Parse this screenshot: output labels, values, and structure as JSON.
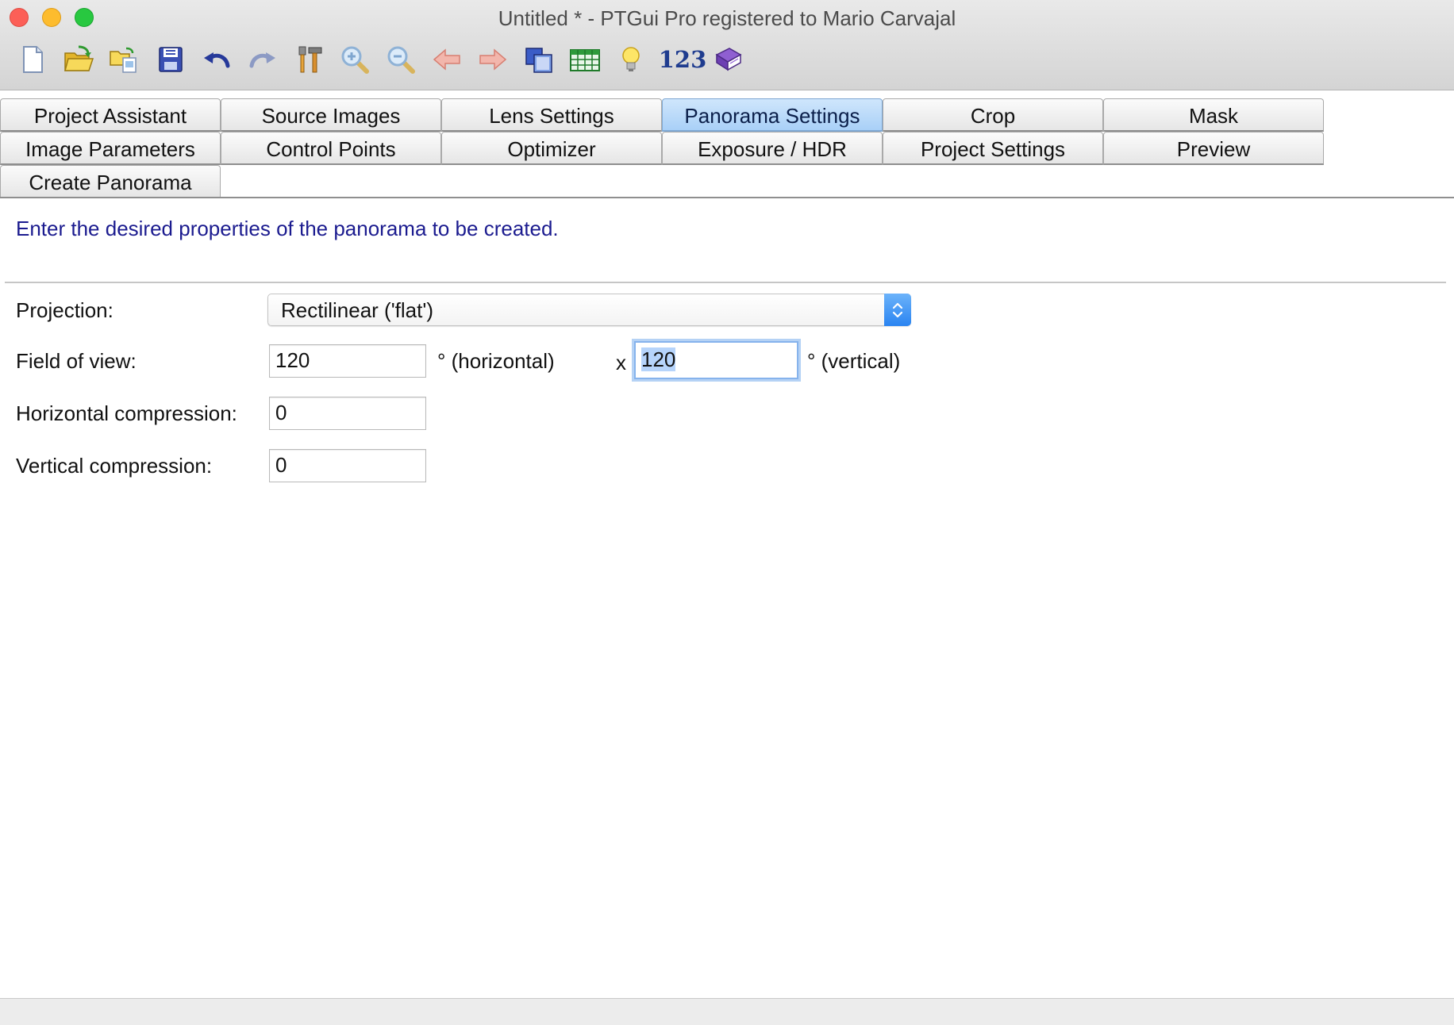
{
  "window": {
    "title": "Untitled * - PTGui Pro registered to Mario Carvajal"
  },
  "toolbar": {
    "buttons": [
      {
        "name": "new-project",
        "icon": "new-document-icon"
      },
      {
        "name": "open-project",
        "icon": "open-folder-icon"
      },
      {
        "name": "load-images",
        "icon": "load-images-icon"
      },
      {
        "name": "save-project",
        "icon": "save-disk-icon"
      },
      {
        "name": "undo",
        "icon": "undo-arrow-icon"
      },
      {
        "name": "redo",
        "icon": "redo-arrow-icon"
      },
      {
        "name": "tools",
        "icon": "tools-icon"
      },
      {
        "name": "zoom-in",
        "icon": "zoom-in-icon"
      },
      {
        "name": "zoom-out",
        "icon": "zoom-out-icon"
      },
      {
        "name": "back",
        "icon": "arrow-left-icon"
      },
      {
        "name": "forward",
        "icon": "arrow-right-icon"
      },
      {
        "name": "panorama-editor",
        "icon": "panorama-editor-icon"
      },
      {
        "name": "table",
        "icon": "table-icon"
      },
      {
        "name": "tips",
        "icon": "lightbulb-icon"
      },
      {
        "name": "numbers",
        "label": "123"
      },
      {
        "name": "help",
        "icon": "help-book-icon"
      }
    ]
  },
  "tabs": {
    "row1": [
      "Project Assistant",
      "Source Images",
      "Lens Settings",
      "Panorama Settings",
      "Crop",
      "Mask"
    ],
    "row2": [
      "Image Parameters",
      "Control Points",
      "Optimizer",
      "Exposure / HDR",
      "Project Settings",
      "Preview"
    ],
    "row3": [
      "Create Panorama"
    ],
    "active": "Panorama Settings"
  },
  "panorama_settings": {
    "hint": "Enter the desired properties of the panorama to be created.",
    "projection_label": "Projection:",
    "projection_value": "Rectilinear ('flat')",
    "fov_label": "Field of view:",
    "fov_horizontal": "120",
    "fov_horizontal_unit": "° (horizontal)",
    "fov_times": "x",
    "fov_vertical": "120",
    "fov_vertical_unit": "° (vertical)",
    "hcomp_label": "Horizontal compression:",
    "hcomp_value": "0",
    "vcomp_label": "Vertical compression:",
    "vcomp_value": "0"
  },
  "colors": {
    "hint_text": "#1b1b8f",
    "active_tab": "#a9d0f7",
    "focus_ring": "#86b3ec",
    "text_selection": "#b6d4fb"
  }
}
